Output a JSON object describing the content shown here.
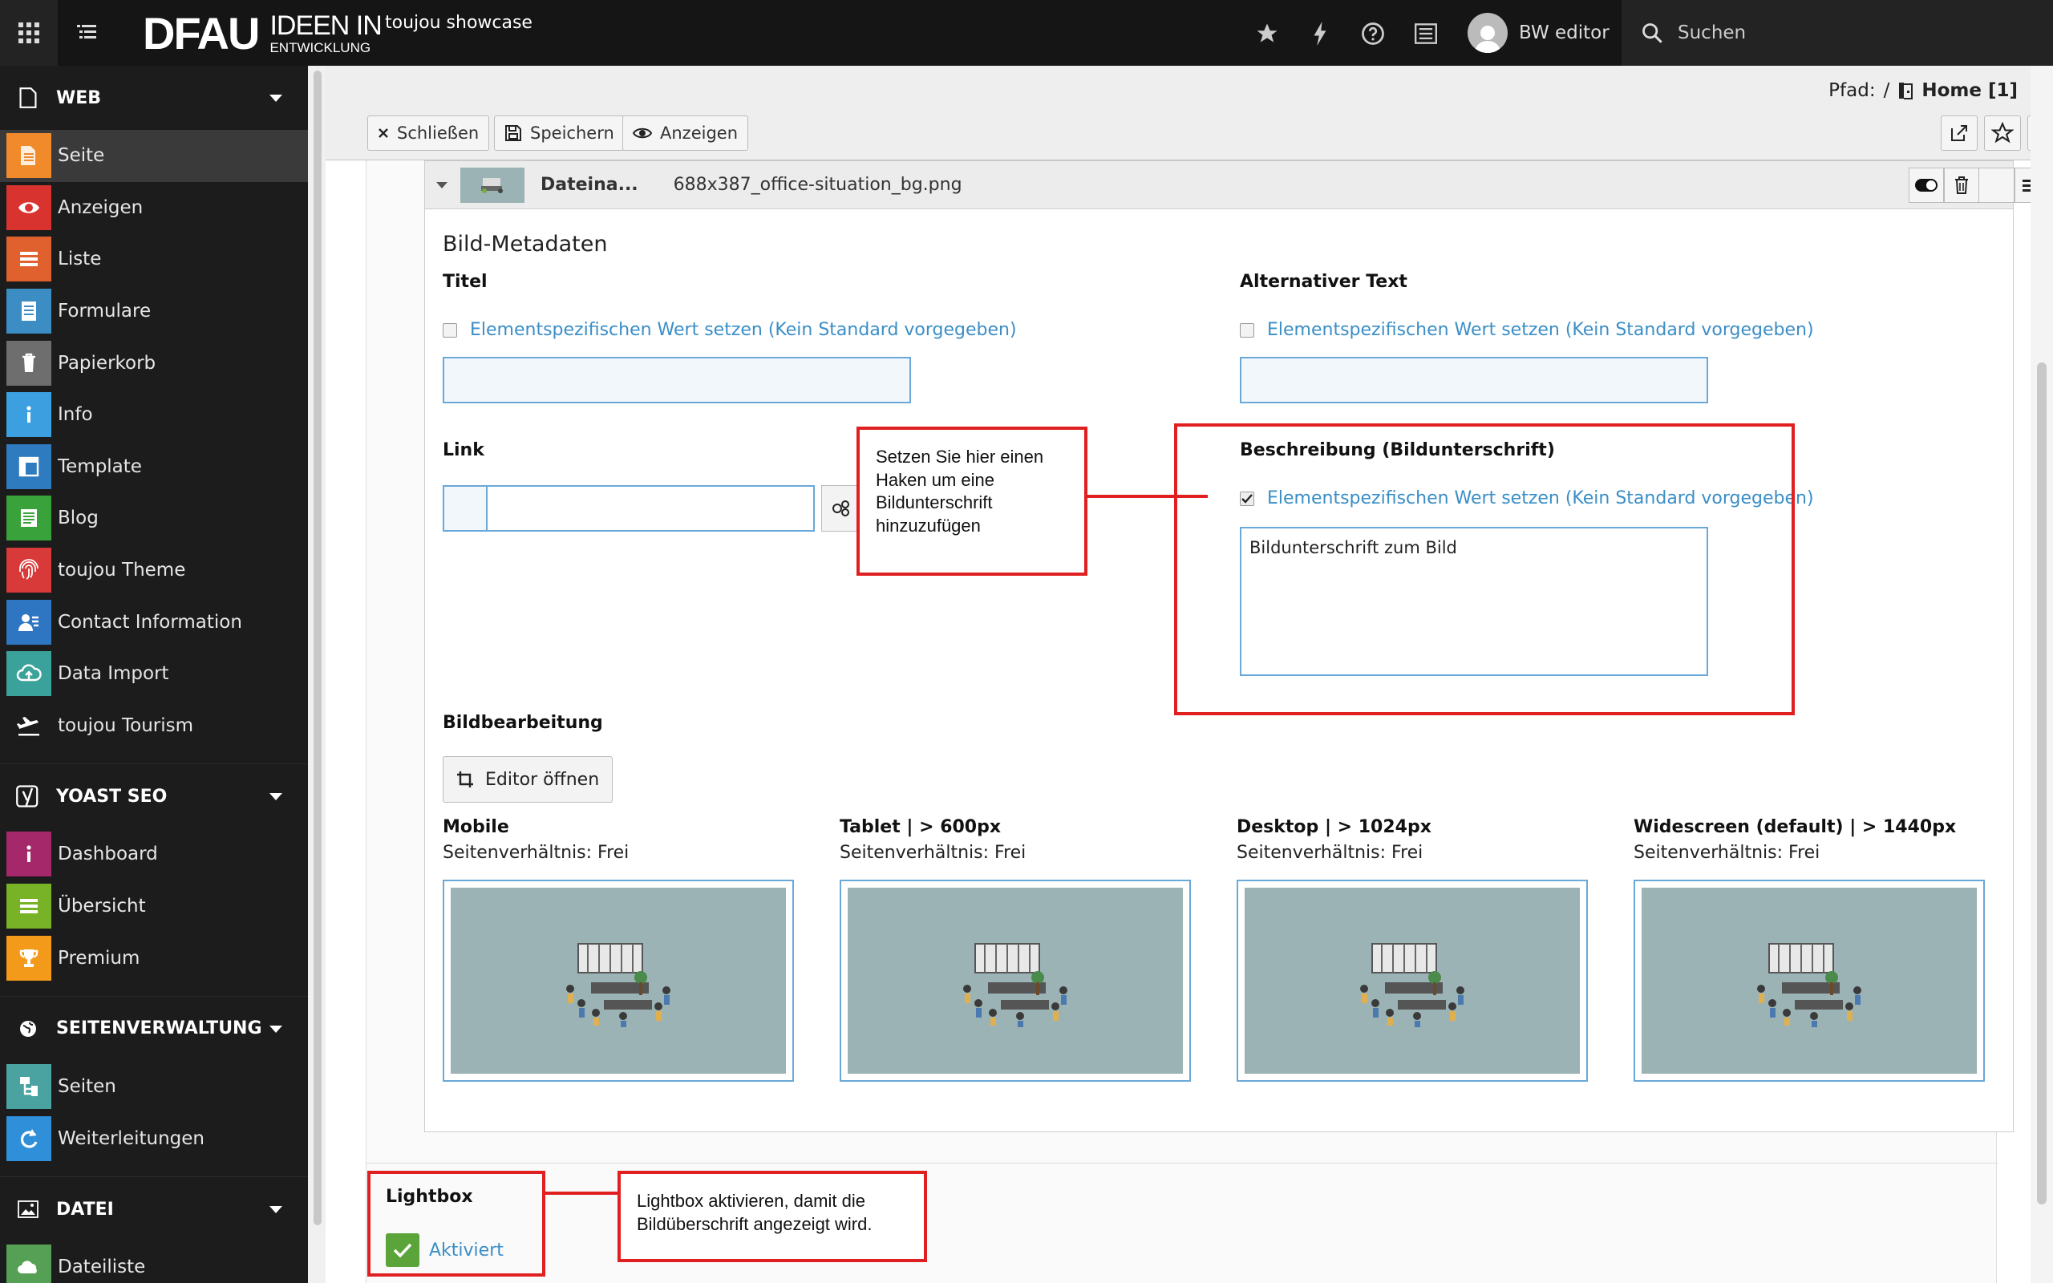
{
  "topbar": {
    "logo_main": "DFAU",
    "logo_line1": "IDEEN IN",
    "logo_line2": "ENTWICKLUNG",
    "site_name": "toujou showcase",
    "user_name": "BW editor",
    "search_label": "Suchen"
  },
  "sidebar": {
    "web_section": "WEB",
    "web_items": [
      {
        "label": "Seite",
        "icon": "page-icon",
        "color": "#f08a2a"
      },
      {
        "label": "Anzeigen",
        "icon": "eye-icon",
        "color": "#d9332f"
      },
      {
        "label": "Liste",
        "icon": "list-icon",
        "color": "#e0612d"
      },
      {
        "label": "Formulare",
        "icon": "form-icon",
        "color": "#3c8dc4"
      },
      {
        "label": "Papierkorb",
        "icon": "trash-icon",
        "color": "#6e6e6e"
      },
      {
        "label": "Info",
        "icon": "info-icon",
        "color": "#3c9fe0"
      },
      {
        "label": "Template",
        "icon": "template-icon",
        "color": "#2e7bbf"
      },
      {
        "label": "Blog",
        "icon": "blog-icon",
        "color": "#3aa23a"
      },
      {
        "label": "toujou Theme",
        "icon": "fingerprint-icon",
        "color": "#d83a3a"
      },
      {
        "label": "Contact Information",
        "icon": "contact-icon",
        "color": "#2e76c2"
      },
      {
        "label": "Data Import",
        "icon": "cloud-upload-icon",
        "color": "#3aa29a"
      },
      {
        "label": "toujou Tourism",
        "icon": "plane-icon",
        "color": "#1c1c1c"
      }
    ],
    "yoast_section": "YOAST SEO",
    "yoast_items": [
      {
        "label": "Dashboard",
        "icon": "info-icon",
        "color": "#a4286a"
      },
      {
        "label": "Übersicht",
        "icon": "list-icon",
        "color": "#77b227"
      },
      {
        "label": "Premium",
        "icon": "trophy-icon",
        "color": "#f49a1a"
      }
    ],
    "pages_section": "SEITENVERWALTUNG",
    "pages_items": [
      {
        "label": "Seiten",
        "icon": "sitemap-icon",
        "color": "#4aa3a0"
      },
      {
        "label": "Weiterleitungen",
        "icon": "redirect-icon",
        "color": "#2f8fd8"
      }
    ],
    "file_section": "DATEI",
    "file_items": [
      {
        "label": "Dateiliste",
        "icon": "filelist-icon",
        "color": "#55a055"
      }
    ]
  },
  "docheader": {
    "path_label": "Pfad:",
    "path_sep": "/",
    "path_page": "Home [1]",
    "close_label": "Schließen",
    "save_label": "Speichern",
    "view_label": "Anzeigen",
    "help_label": "?"
  },
  "file_ref": {
    "label": "Dateina...",
    "filename": "688x387_office-situation_bg.png"
  },
  "metadata": {
    "heading": "Bild-Metadaten",
    "title_label": "Titel",
    "alt_label": "Alternativer Text",
    "override_text": "Elementspezifischen Wert setzen (Kein Standard vorgegeben)",
    "link_label": "Link",
    "description_label": "Beschreibung (Bildunterschrift)",
    "description_value": "Bildunterschrift zum Bild",
    "imageedit_label": "Bildbearbeitung",
    "editor_button": "Editor öffnen"
  },
  "crop_variants": [
    {
      "title": "Mobile",
      "ratio": "Seitenverhältnis: Frei"
    },
    {
      "title": "Tablet | > 600px",
      "ratio": "Seitenverhältnis: Frei"
    },
    {
      "title": "Desktop | > 1024px",
      "ratio": "Seitenverhältnis: Frei"
    },
    {
      "title": "Widescreen (default) | > 1440px",
      "ratio": "Seitenverhältnis: Frei"
    }
  ],
  "lightbox": {
    "label": "Lightbox",
    "toggle_label": "Aktiviert"
  },
  "annotations": {
    "caption_hint": "Setzen Sie hier einen Haken um eine Bildunterschrift hinzuzufügen",
    "lightbox_hint": "Lightbox aktivieren, damit die Bildüberschrift angezeigt wird."
  },
  "colors": {
    "accent_link": "#3a8ec7",
    "annotation_red": "#e02020",
    "lightbox_green": "#5aa43a"
  }
}
